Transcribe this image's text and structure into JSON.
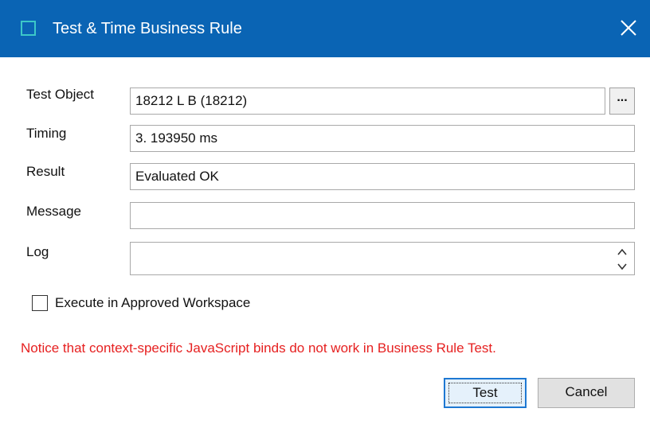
{
  "window": {
    "title": "Test & Time Business Rule",
    "icon": "app-window-icon",
    "close_icon": "close-icon",
    "titlebar_color": "#0a64b4"
  },
  "form": {
    "test_object": {
      "label": "Test Object",
      "value": "18212 L B (18212)",
      "browse_label": "..."
    },
    "timing": {
      "label": "Timing",
      "value": "3. 193950 ms"
    },
    "result": {
      "label": "Result",
      "value": "Evaluated OK"
    },
    "message": {
      "label": "Message",
      "value": ""
    },
    "log": {
      "label": "Log",
      "value": ""
    }
  },
  "options": {
    "execute_approved": {
      "label": "Execute in Approved Workspace",
      "checked": false
    }
  },
  "notice": {
    "text": "Notice that context-specific JavaScript binds do not work in Business Rule Test.",
    "color": "#e62020"
  },
  "buttons": {
    "test": "Test",
    "cancel": "Cancel"
  }
}
